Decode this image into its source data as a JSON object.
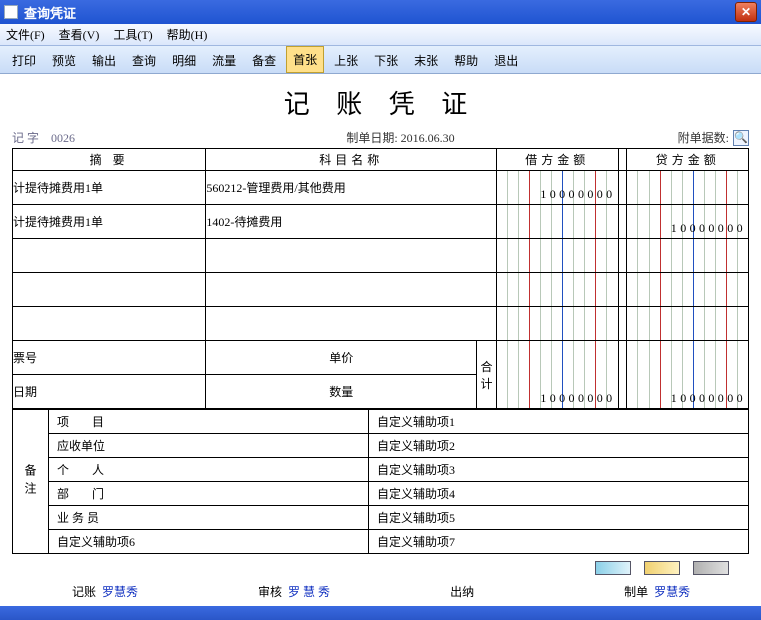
{
  "window": {
    "title": "查询凭证"
  },
  "menu": {
    "file": "文件(F)",
    "view": "查看(V)",
    "tool": "工具(T)",
    "help": "帮助(H)"
  },
  "toolbar": {
    "print": "打印",
    "preview": "预览",
    "output": "输出",
    "query": "查询",
    "detail": "明细",
    "flow": "流量",
    "check": "备查",
    "first": "首张",
    "prev": "上张",
    "next": "下张",
    "last": "末张",
    "thelp": "帮助",
    "exit": "退出"
  },
  "voucher": {
    "title": "记 账 凭 证",
    "word_label": "记  字",
    "number": "0026",
    "date_label": "制单日期:",
    "date": "2016.06.30",
    "attach_label": "附单据数:",
    "headers": {
      "summary": "摘 要",
      "subject": "科目名称",
      "debit": "借方金额",
      "credit": "贷方金额"
    },
    "rows": [
      {
        "summary": "计提待摊费用1单",
        "subject": "560212-管理费用/其他费用",
        "debit": "10000000",
        "credit": ""
      },
      {
        "summary": "计提待摊费用1单",
        "subject": "1402-待摊费用",
        "debit": "",
        "credit": "10000000"
      },
      {
        "summary": "",
        "subject": "",
        "debit": "",
        "credit": ""
      },
      {
        "summary": "",
        "subject": "",
        "debit": "",
        "credit": ""
      },
      {
        "summary": "",
        "subject": "",
        "debit": "",
        "credit": ""
      }
    ],
    "midblock": {
      "ticket_label": "票号",
      "price_label": "单价",
      "date_label": "日期",
      "qty_label": "数量",
      "total_label": "合 计",
      "total_debit": "10000000",
      "total_credit": "10000000"
    },
    "notes": {
      "side_label": "备注",
      "left": [
        "项    目",
        "应收单位",
        "个    人",
        "部    门",
        "业 务 员",
        "自定义辅助项6"
      ],
      "right": [
        "自定义辅助项1",
        "自定义辅助项2",
        "自定义辅助项3",
        "自定义辅助项4",
        "自定义辅助项5",
        "自定义辅助项7"
      ]
    },
    "signatures": {
      "book_label": "记账",
      "book_name": "罗慧秀",
      "audit_label": "审核",
      "audit_name": "罗 慧 秀",
      "cashier_label": "出纳",
      "maker_label": "制单",
      "maker_name": "罗慧秀"
    }
  }
}
